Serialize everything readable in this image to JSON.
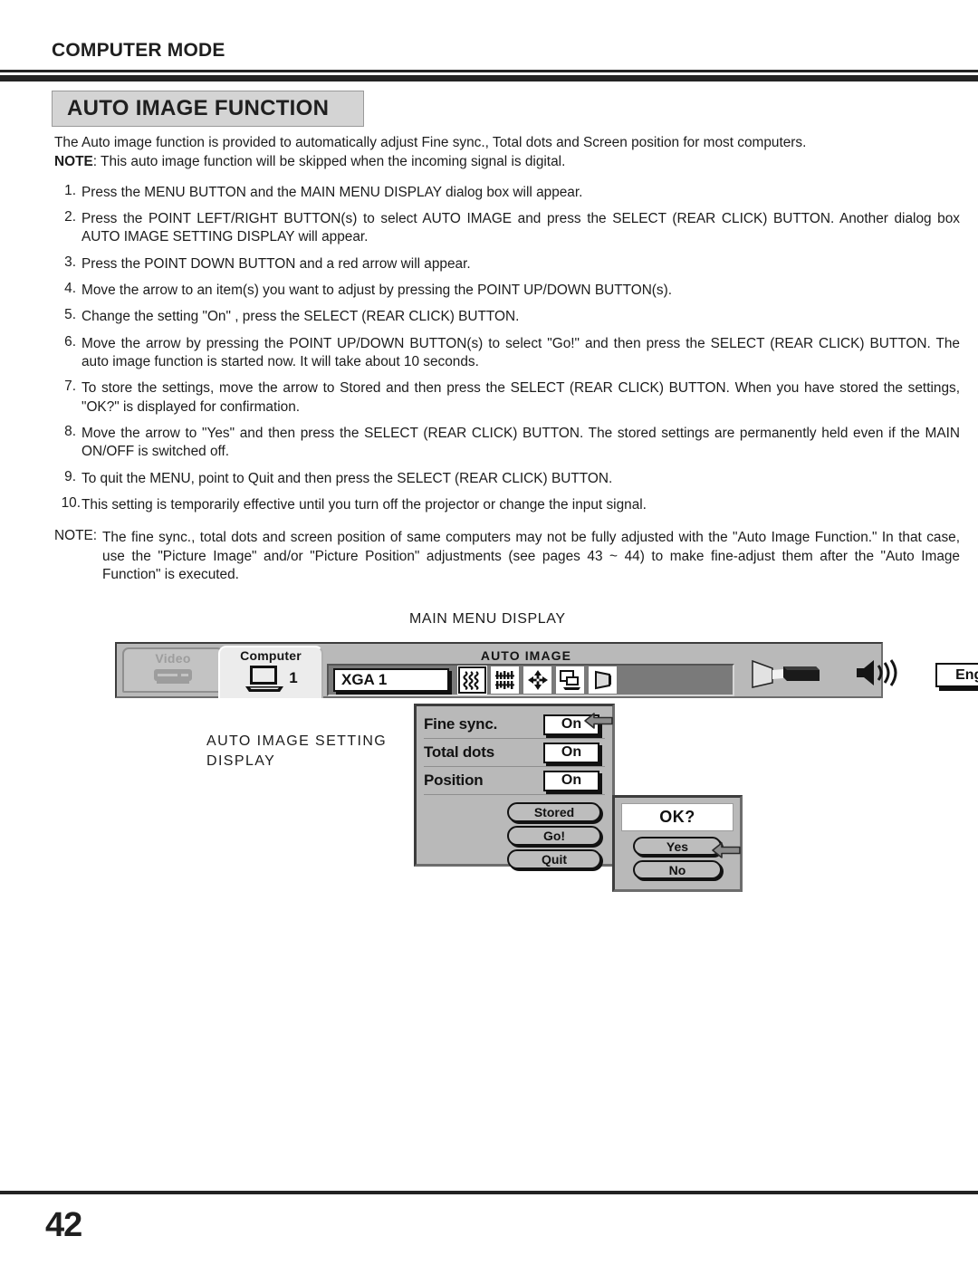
{
  "header": {
    "mode_title": "COMPUTER MODE",
    "section_title": "AUTO IMAGE FUNCTION"
  },
  "intro": {
    "description": "The Auto image function is provided to automatically adjust Fine sync., Total dots and Screen position for most computers.",
    "note_label": "NOTE",
    "note_text": ": This auto image function will be skipped when the incoming signal is digital."
  },
  "steps": [
    {
      "number": "1.",
      "text": "Press the MENU BUTTON and the MAIN MENU DISPLAY dialog box will appear."
    },
    {
      "number": "2.",
      "text": "Press the POINT LEFT/RIGHT BUTTON(s) to select AUTO IMAGE and press the SELECT (REAR CLICK) BUTTON. Another dialog  box AUTO IMAGE SETTING DISPLAY will appear."
    },
    {
      "number": "3.",
      "text": "Press the POINT DOWN BUTTON and a red arrow will appear."
    },
    {
      "number": "4.",
      "text": "Move the arrow to an item(s) you want to adjust by pressing the POINT UP/DOWN BUTTON(s)."
    },
    {
      "number": "5.",
      "text": "Change the setting \"On\" , press the SELECT (REAR CLICK) BUTTON."
    },
    {
      "number": "6.",
      "text": "Move the arrow by pressing the POINT UP/DOWN BUTTON(s) to select \"Go!\" and then press the SELECT (REAR CLICK) BUTTON. The auto image function is started now. It will take about 10 seconds."
    },
    {
      "number": "7.",
      "text": "To store the settings, move the arrow to Stored and then press the SELECT (REAR CLICK) BUTTON.  When you have stored the settings, \"OK?\" is displayed for confirmation."
    },
    {
      "number": "8.",
      "text": "Move the arrow to \"Yes\" and then press the SELECT (REAR CLICK) BUTTON. The stored settings are permanently held even if the MAIN ON/OFF is switched off."
    },
    {
      "number": "9.",
      "text": "To quit the MENU, point to Quit and then press the SELECT (REAR CLICK) BUTTON."
    },
    {
      "number": "10.",
      "text": "This setting is temporarily effective until you turn off the projector or change the input signal."
    }
  ],
  "closing_note": {
    "label": "NOTE:",
    "text": "The fine sync., total dots and screen position of same computers may not be fully adjusted with the \"Auto Image Function.\"  In that case, use the \"Picture Image\" and/or \"Picture Position\" adjustments (see pages 43 ~ 44) to make fine-adjust them after the \"Auto Image Function\" is executed."
  },
  "figure": {
    "main_menu_caption": "MAIN MENU DISPLAY",
    "setting_caption_line1": "AUTO IMAGE SETTING",
    "setting_caption_line2": "DISPLAY",
    "osd": {
      "tab_video": "Video",
      "tab_computer": "Computer",
      "computer_number": "1",
      "menu_title": "AUTO IMAGE",
      "source_value": "XGA 1",
      "language_value": "English",
      "icons": [
        "fine-sync-icon",
        "total-dots-icon",
        "position-icon",
        "picture-screen-icon",
        "keystone-icon"
      ],
      "right_icons": [
        "projector-icon",
        "sound-icon"
      ]
    },
    "setting_panel": {
      "rows": [
        {
          "label": "Fine sync.",
          "value": "On"
        },
        {
          "label": "Total dots",
          "value": "On"
        },
        {
          "label": "Position",
          "value": "On"
        }
      ],
      "buttons": [
        "Stored",
        "Go!",
        "Quit"
      ]
    },
    "ok_dialog": {
      "title": "OK?",
      "buttons": [
        "Yes",
        "No"
      ]
    },
    "arrow_color": "#8c8c8c"
  },
  "footer": {
    "page_number": "42"
  }
}
